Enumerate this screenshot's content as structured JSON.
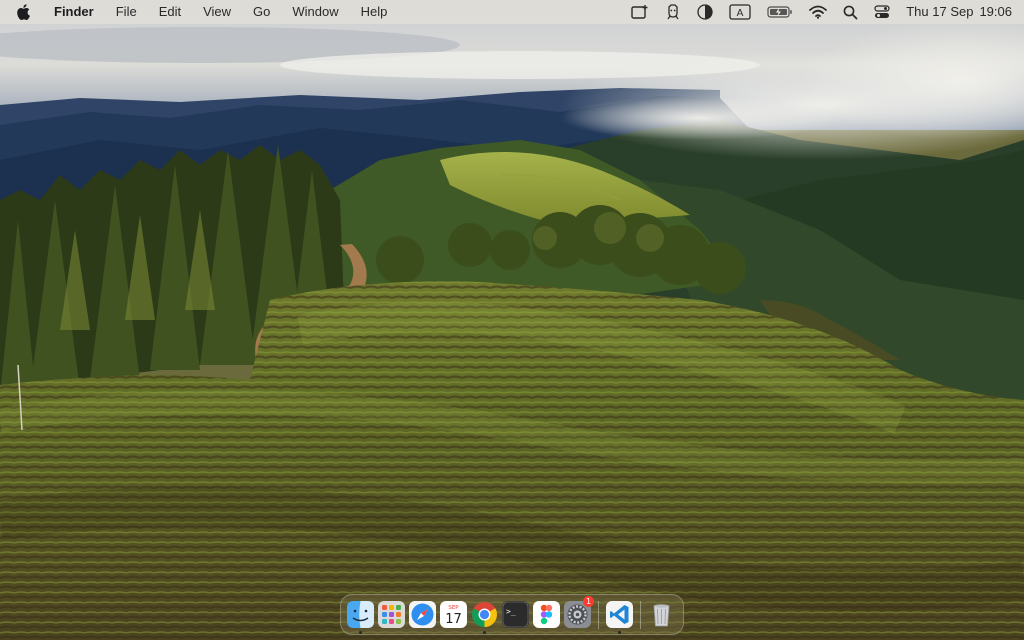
{
  "menubar": {
    "apple_icon": "apple-logo",
    "app_name": "Finder",
    "items": [
      "File",
      "Edit",
      "View",
      "Go",
      "Window",
      "Help"
    ],
    "status_icons": [
      "screen-capture-icon",
      "character-viewer-icon",
      "display-icon",
      "input-source-icon",
      "battery-icon",
      "wifi-icon",
      "spotlight-search-icon",
      "control-center-icon"
    ],
    "input_source_letter": "A",
    "clock": {
      "date": "Thu 17 Sep",
      "time": "19:06"
    }
  },
  "dock": {
    "items": [
      {
        "name": "Finder",
        "icon": "finder-icon",
        "running": true
      },
      {
        "name": "Launchpad",
        "icon": "launchpad-icon",
        "running": false
      },
      {
        "name": "Safari",
        "icon": "safari-icon",
        "running": false
      },
      {
        "name": "Calendar",
        "icon": "calendar-icon",
        "running": false,
        "month": "SEP",
        "day": "17"
      },
      {
        "name": "Google Chrome",
        "icon": "chrome-icon",
        "running": true
      },
      {
        "name": "Terminal",
        "icon": "terminal-icon",
        "running": false,
        "glyph": ">_"
      },
      {
        "name": "Figma",
        "icon": "figma-icon",
        "running": false
      },
      {
        "name": "System Settings",
        "icon": "settings-icon",
        "running": false,
        "badge": "1"
      },
      {
        "name": "Visual Studio Code",
        "icon": "vscode-icon",
        "running": true
      },
      {
        "name": "Trash",
        "icon": "trash-icon",
        "running": false
      }
    ]
  },
  "wallpaper": "vineyard-hills"
}
